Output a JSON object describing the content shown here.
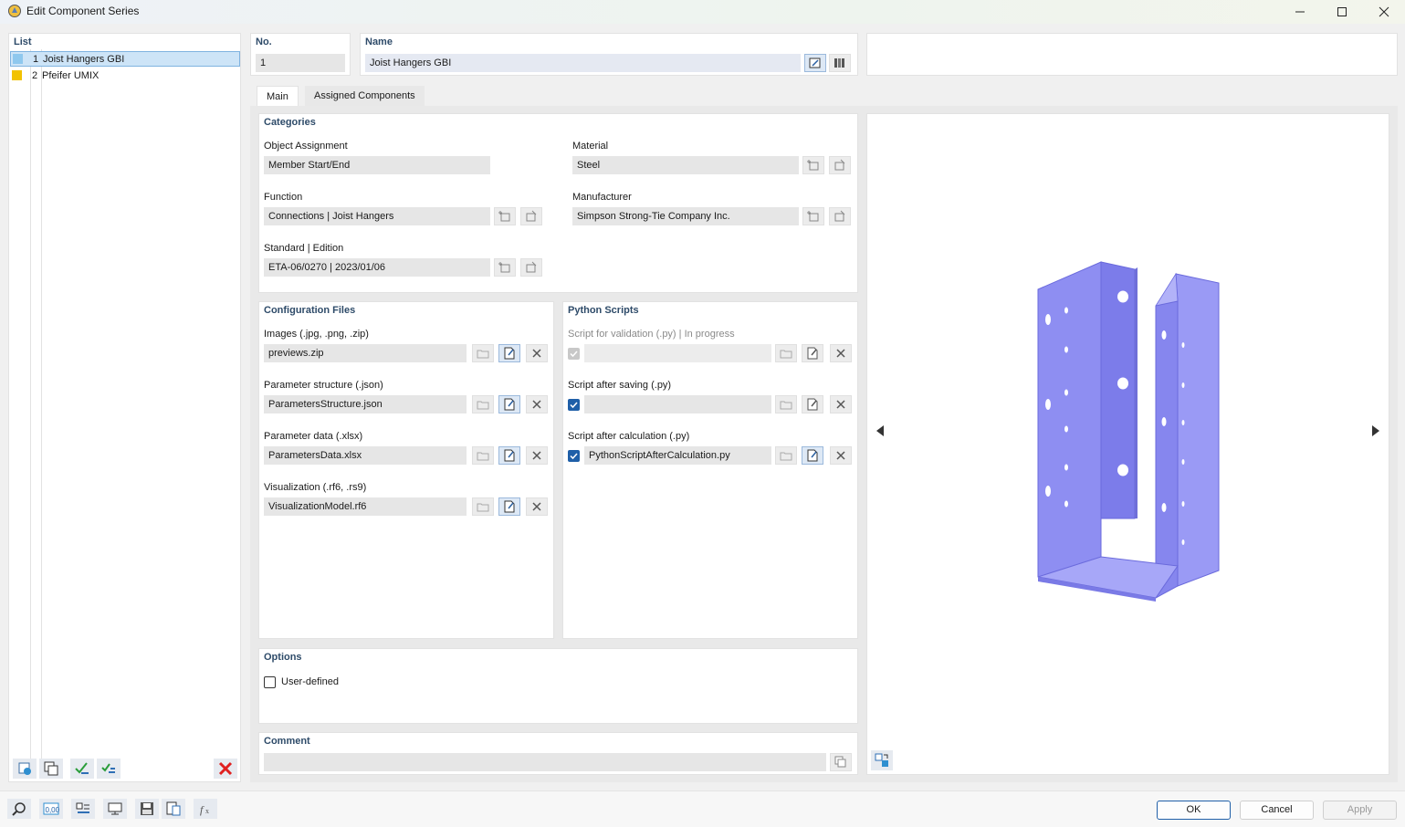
{
  "window": {
    "title": "Edit Component Series",
    "min_icon": "minimize-icon",
    "max_icon": "maximize-icon",
    "close_icon": "close-icon"
  },
  "list": {
    "header": "List",
    "items": [
      {
        "no": "1",
        "name": "Joist Hangers GBI",
        "color": "#8fc8ee",
        "selected": true
      },
      {
        "no": "2",
        "name": "Pfeifer UMIX",
        "color": "#f2c200",
        "selected": false
      }
    ]
  },
  "no": {
    "label": "No.",
    "value": "1"
  },
  "name": {
    "label": "Name",
    "value": "Joist Hangers GBI"
  },
  "tabs": [
    {
      "label": "Main",
      "active": true
    },
    {
      "label": "Assigned Components",
      "active": false
    }
  ],
  "categories": {
    "header": "Categories",
    "object_assignment": {
      "label": "Object Assignment",
      "value": "Member Start/End"
    },
    "function": {
      "label": "Function",
      "value": "Connections | Joist Hangers"
    },
    "standard": {
      "label": "Standard | Edition",
      "value": "ETA-06/0270 | 2023/01/06"
    },
    "material": {
      "label": "Material",
      "value": "Steel"
    },
    "manufacturer": {
      "label": "Manufacturer",
      "value": "Simpson Strong-Tie Company Inc."
    }
  },
  "config_files": {
    "header": "Configuration Files",
    "images": {
      "label": "Images (.jpg, .png, .zip)",
      "value": "previews.zip"
    },
    "param_structure": {
      "label": "Parameter structure (.json)",
      "value": "ParametersStructure.json"
    },
    "param_data": {
      "label": "Parameter data (.xlsx)",
      "value": "ParametersData.xlsx"
    },
    "visualization": {
      "label": "Visualization (.rf6, .rs9)",
      "value": "VisualizationModel.rf6"
    }
  },
  "python_scripts": {
    "header": "Python Scripts",
    "validation": {
      "label": "Script for validation (.py) | In progress",
      "value": ""
    },
    "after_saving": {
      "label": "Script after saving (.py)",
      "value": ""
    },
    "after_calculation": {
      "label": "Script after calculation (.py)",
      "value": "PythonScriptAfterCalculation.py"
    }
  },
  "options": {
    "header": "Options",
    "user_defined": "User-defined"
  },
  "comment": {
    "header": "Comment",
    "value": ""
  },
  "preview": {
    "shape_color": "#9595f4",
    "prev_icon": "arrow-left-icon",
    "next_icon": "arrow-right-icon"
  },
  "footer": {
    "ok": "OK",
    "cancel": "Cancel",
    "apply": "Apply"
  },
  "colors": {
    "accent": "#1f5fa8",
    "header_text": "#2e4b69",
    "delete_red": "#e02020"
  }
}
